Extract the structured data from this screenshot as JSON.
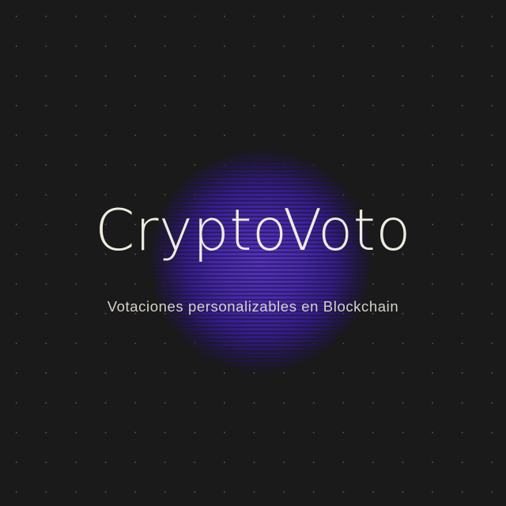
{
  "logo": {
    "title": "CryptoVoto",
    "tagline": "Votaciones personalizables en Blockchain"
  },
  "colors": {
    "background": "#1a1a1a",
    "dot_grid": "#4a4a4a",
    "glow": "#5530c8",
    "title_text": "#efecdf",
    "tagline_text": "#d6d2c6"
  }
}
